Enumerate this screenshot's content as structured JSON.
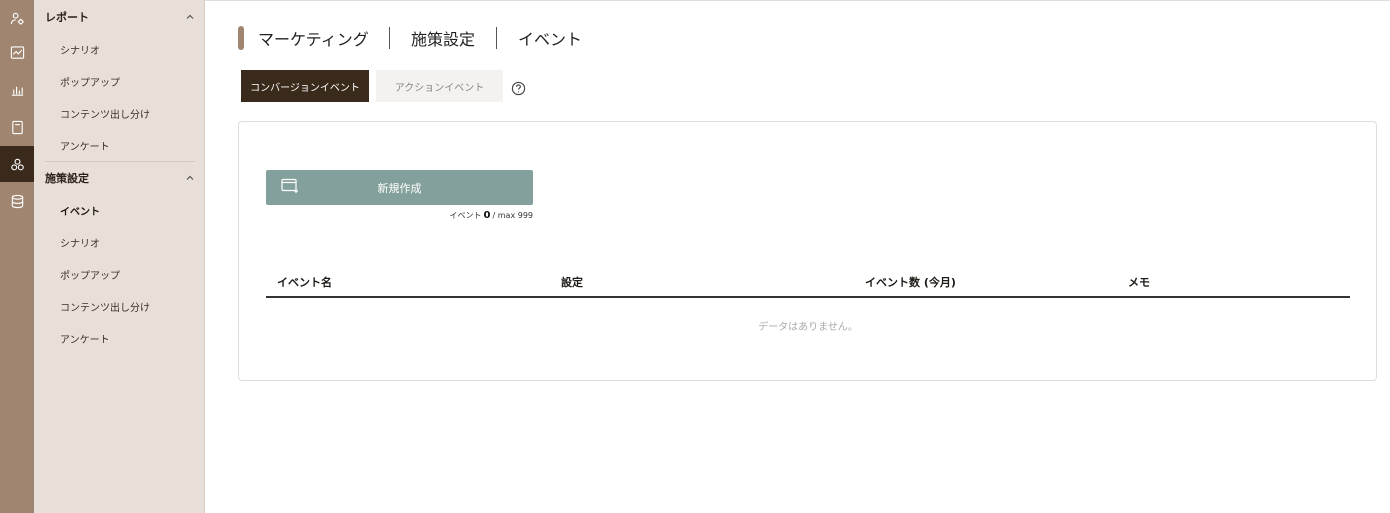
{
  "breadcrumb": {
    "items": [
      "マーケティング",
      "施策設定",
      "イベント"
    ]
  },
  "tabs": [
    {
      "label": "コンバージョンイベント",
      "active": true
    },
    {
      "label": "アクションイベント",
      "active": false
    }
  ],
  "sidebar": {
    "sections": [
      {
        "title": "レポート",
        "items": [
          "シナリオ",
          "ポップアップ",
          "コンテンツ出し分け",
          "アンケート"
        ]
      },
      {
        "title": "施策設定",
        "items": [
          "イベント",
          "シナリオ",
          "ポップアップ",
          "コンテンツ出し分け",
          "アンケート"
        ],
        "current": "イベント"
      }
    ]
  },
  "rail": {
    "icons": [
      "user-settings-icon",
      "chart-line-icon",
      "bar-chart-icon",
      "document-icon",
      "marketing-icon",
      "database-icon"
    ],
    "active": "marketing-icon"
  },
  "create": {
    "label": "新規作成"
  },
  "counter": {
    "prefix": "イベント",
    "count": "0",
    "suffix": "/ max 999"
  },
  "table": {
    "headers": [
      "イベント名",
      "設定",
      "イベント数 (今月)",
      "メモ"
    ],
    "empty_text": "データはありません。"
  },
  "colors": {
    "accent": "#3a2a1c",
    "rail": "#a08670",
    "sidebar": "#e8e0d8",
    "create_button": "#84a09c"
  }
}
